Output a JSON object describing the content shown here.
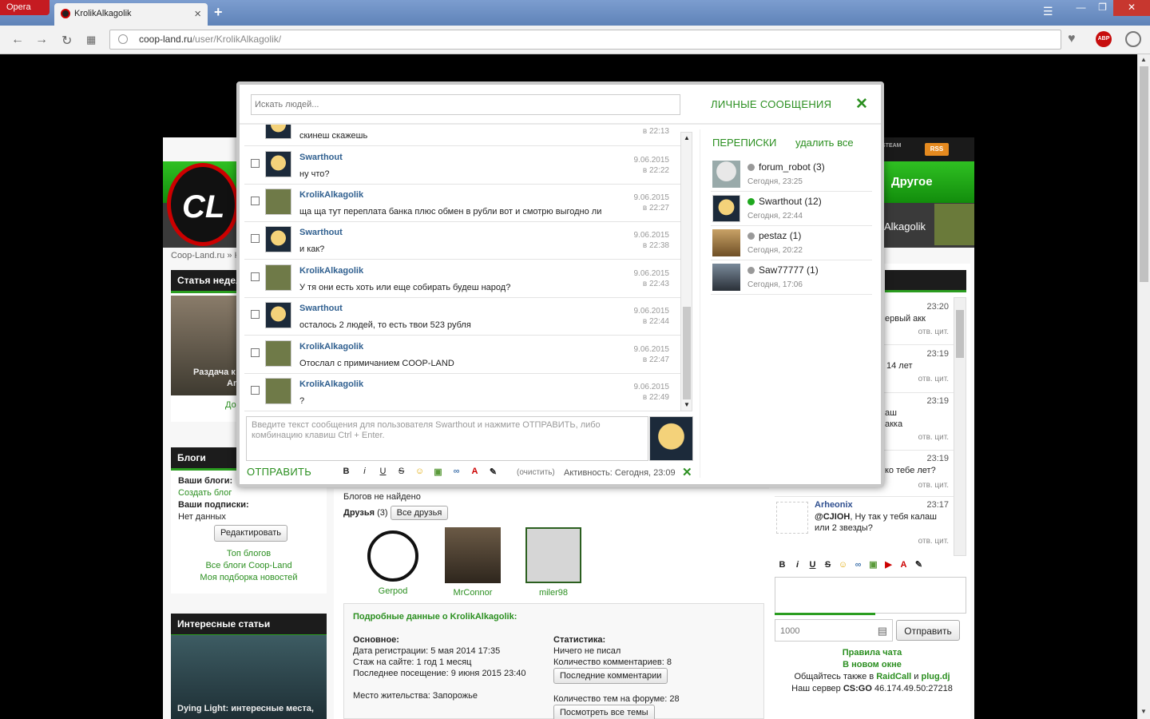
{
  "browser": {
    "opera_label": "Opera",
    "tab_title": "KrolikAlkagolik",
    "url_host": "coop-land.ru",
    "url_path": "/user/KrolikAlkagolik/",
    "abp_label": "ABP"
  },
  "site": {
    "steam_label": "STEAM",
    "rss_label": "RSS",
    "nav_other": "Другое",
    "user_label": "Alkagolik",
    "breadcrumb": "Coop-Land.ru » K",
    "box1": {
      "title": "Статья недел",
      "caption1": "Раздача к",
      "caption2": "Armore",
      "link": "До"
    },
    "box2": {
      "title": "Блоги",
      "your_blogs": "Ваши блоги:",
      "create_blog": "Создать блог",
      "subs": "Ваши подписки:",
      "no_data": "Нет данных",
      "edit_btn": "Редактировать",
      "top_blogs": "Топ блогов",
      "all_blogs": "Все блоги Coop-Land",
      "my_news": "Моя подборка новостей"
    },
    "box3": {
      "title": "Интересные статьи",
      "caption": "Dying Light: интересные места,"
    }
  },
  "profile": {
    "blogs_none": "Блогов не найдено",
    "friends_label": "Друзья",
    "friends_count": "(3)",
    "all_friends_btn": "Все друзья",
    "friends": [
      {
        "name": "Gerpod"
      },
      {
        "name": "MrConnor"
      },
      {
        "name": "miler98"
      }
    ],
    "details_title": "Подробные данные о KrolikAlkagolik:",
    "basic_label": "Основное:",
    "reg_date": "Дата регистрации: 5 мая 2014 17:35",
    "tenure": "Стаж на сайте: 1 год 1 месяц",
    "last_visit": "Последнее посещение: 9 июня 2015 23:40",
    "residence": "Место жительства: Запорожье",
    "stats_label": "Статистика:",
    "wrote_nothing": "Ничего не писал",
    "comments_count": "Количество комментариев: 8",
    "last_comments_btn": "Последние комментарии",
    "forum_topics": "Количество тем на форуме: 28",
    "view_topics_btn": "Посмотреть все темы"
  },
  "chat": {
    "messages": [
      {
        "time": "23:20",
        "text": "ервый акк",
        "act": "отв. цит."
      },
      {
        "time": "23:19",
        "text": "14 лет",
        "act": "отв. цит."
      },
      {
        "time": "23:19",
        "text": "аш",
        "text2": "акка",
        "act": "отв. цит."
      },
      {
        "time": "23:19",
        "text": "ко тебе лет?",
        "act": "отв. цит."
      }
    ],
    "arheonix": {
      "name": "Arheonix",
      "time": "23:17",
      "mention": "@CJIOH",
      "text": ", Ну так у тебя калаш",
      "text2": "или 2 звезды?",
      "act": "отв. цит."
    },
    "counter": "1000",
    "send_btn": "Отправить",
    "rules": "Правила чата",
    "new_window": "В новом окне",
    "also_prefix": "Общайтесь также в ",
    "raidcall": "RaidCall",
    "and": " и ",
    "plugdj": "plug.dj",
    "server_prefix": "Наш сервер ",
    "server_game": "CS:GO",
    "server_addr": " 46.174.49.50:27218"
  },
  "pm": {
    "search_placeholder": "Искать людей...",
    "title": "ЛИЧНЫЕ СООБЩЕНИЯ",
    "partial_text": "скинеш скажешь",
    "partial_time": "в 22:13",
    "messages": [
      {
        "author": "Swarthout",
        "text": "ну что?",
        "date": "9.06.2015",
        "time": "в 22:22"
      },
      {
        "author": "KrolikAlkagolik",
        "text": "ща ща тут переплата банка плюс обмен в рубли вот и смотрю выгодно ли",
        "date": "9.06.2015",
        "time": "в 22:27"
      },
      {
        "author": "Swarthout",
        "text": "и как?",
        "date": "9.06.2015",
        "time": "в 22:38"
      },
      {
        "author": "KrolikAlkagolik",
        "text": "У тя они есть хоть или еще собирать будеш народ?",
        "date": "9.06.2015",
        "time": "в 22:43"
      },
      {
        "author": "Swarthout",
        "text": "осталось 2 людей, то есть твои 523 рубля",
        "date": "9.06.2015",
        "time": "в 22:44"
      },
      {
        "author": "KrolikAlkagolik",
        "text": "Отослал с примичанием COOP-LAND",
        "date": "9.06.2015",
        "time": "в 22:47"
      },
      {
        "author": "KrolikAlkagolik",
        "text": "?",
        "date": "9.06.2015",
        "time": "в 22:49"
      }
    ],
    "compose_placeholder": "Введите текст сообщения для пользователя Swarthout и нажмите ОТПРАВИТЬ, либо комбинацию клавиш Ctrl + Enter.",
    "send_label": "ОТПРАВИТЬ",
    "clear_label": "(очистить)",
    "activity": "Активность: Сегодня, 23:09",
    "correspondence_title": "ПЕРЕПИСКИ",
    "delete_all": "удалить все",
    "conversations": [
      {
        "name": "forum_robot (3)",
        "time": "Сегодня, 23:25",
        "online": false
      },
      {
        "name": "Swarthout (12)",
        "time": "Сегодня, 22:44",
        "online": true
      },
      {
        "name": "pestaz (1)",
        "time": "Сегодня, 20:22",
        "online": false
      },
      {
        "name": "Saw77777 (1)",
        "time": "Сегодня, 17:06",
        "online": false
      }
    ]
  }
}
